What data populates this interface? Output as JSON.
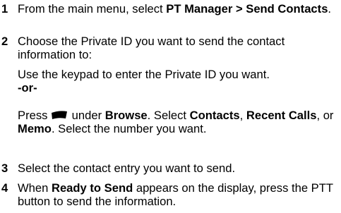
{
  "steps": [
    {
      "number": "1",
      "text_before": "From the main menu, select ",
      "bold": "PT Manager > Send Contacts",
      "text_after": "."
    },
    {
      "number": "2",
      "text": "Choose the Private ID you want to send the contact information to:"
    },
    {
      "number": "3",
      "text": "Select the contact entry you want to send."
    },
    {
      "number": "4",
      "text_before": "When ",
      "bold": "Ready to Send",
      "text_after": " appears on the display, press the PTT button to send the information."
    }
  ],
  "sub": {
    "keypad_text": "Use the keypad to enter the Private ID you want.",
    "or_label": "-or-",
    "press_label": "Press",
    "softkey_icon": "left-softkey-icon",
    "under_label": " under ",
    "browse_label": "Browse",
    "select_label": ". Select ",
    "contacts_label": "Contacts",
    "comma_label": ",",
    "recent_calls_label": "Recent Calls",
    "or_text": ", or ",
    "memo_label": "Memo",
    "tail_text": ". Select the number you want."
  }
}
